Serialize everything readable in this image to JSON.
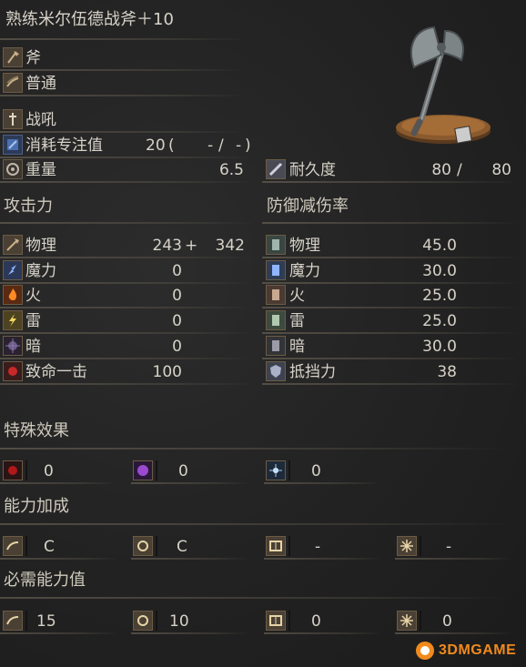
{
  "title": "熟练米尔伍德战斧＋10",
  "info": {
    "weapon_type": "斧",
    "attack_type": "普通",
    "skill": "战吼",
    "fp_cost_label": "消耗专注值",
    "fp_cost_value": "20",
    "fp_cost_mid": "-",
    "fp_cost_right": "-",
    "weight_label": "重量",
    "weight_value": "6.5",
    "durability_label": "耐久度",
    "durability_current": "80",
    "durability_max": "80"
  },
  "attack": {
    "header": "攻击力",
    "rows": [
      {
        "label": "物理",
        "value": "243",
        "bonus_sign": "+",
        "bonus": "342"
      },
      {
        "label": "魔力",
        "value": "0"
      },
      {
        "label": "火",
        "value": "0"
      },
      {
        "label": "雷",
        "value": "0"
      },
      {
        "label": "暗",
        "value": "0"
      },
      {
        "label": "致命一击",
        "value": "100"
      }
    ]
  },
  "defense": {
    "header": "防御减伤率",
    "rows": [
      {
        "label": "物理",
        "value": "45.0"
      },
      {
        "label": "魔力",
        "value": "30.0"
      },
      {
        "label": "火",
        "value": "25.0"
      },
      {
        "label": "雷",
        "value": "25.0"
      },
      {
        "label": "暗",
        "value": "30.0"
      },
      {
        "label": "抵挡力",
        "value": "38"
      }
    ]
  },
  "effects": {
    "header": "特殊效果",
    "items": [
      {
        "icon": "bleed-icon",
        "value": "0"
      },
      {
        "icon": "poison-icon",
        "value": "0"
      },
      {
        "icon": "frost-icon",
        "value": "0"
      }
    ]
  },
  "scaling": {
    "header": "能力加成",
    "items": [
      {
        "icon": "strength-icon",
        "value": "C"
      },
      {
        "icon": "dexterity-icon",
        "value": "C"
      },
      {
        "icon": "intelligence-icon",
        "value": "-"
      },
      {
        "icon": "faith-icon",
        "value": "-"
      }
    ]
  },
  "requirements": {
    "header": "必需能力值",
    "items": [
      {
        "icon": "strength-icon",
        "value": "15"
      },
      {
        "icon": "dexterity-icon",
        "value": "10"
      },
      {
        "icon": "intelligence-icon",
        "value": "0"
      },
      {
        "icon": "faith-icon",
        "value": "0"
      }
    ]
  },
  "watermark": "3DMGAME",
  "colors": {
    "background": "#232323",
    "text": "#d6d2c8",
    "icon_frame": "#6b5b45",
    "bleed": "#b0181a",
    "poison": "#9b4ad0",
    "frost": "#9fd0ff",
    "watermark_orange": "#f08a1c"
  }
}
